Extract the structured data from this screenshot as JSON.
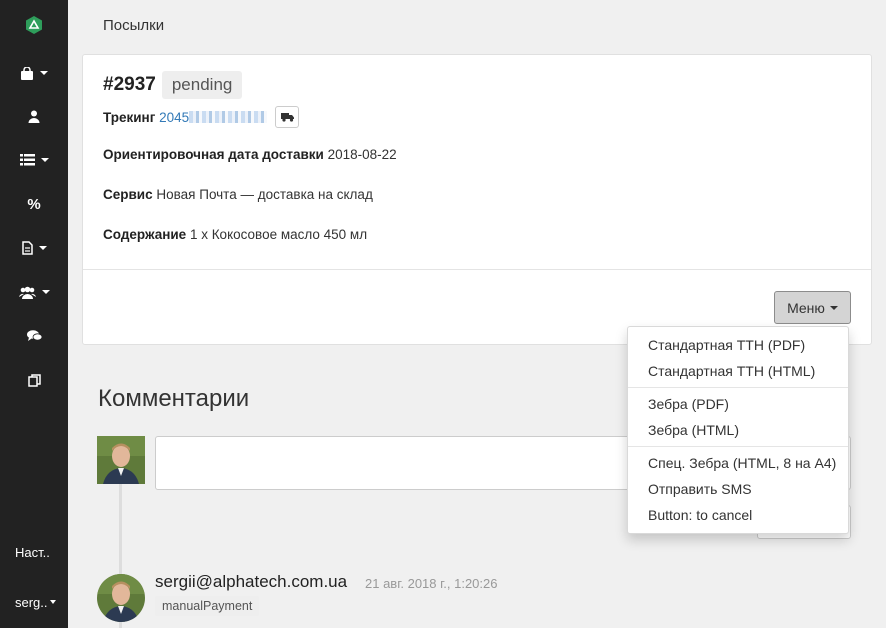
{
  "sidebar": {
    "items": [
      {
        "icon": "shopping-bag-icon",
        "has_caret": true
      },
      {
        "icon": "user-icon",
        "has_caret": false
      },
      {
        "icon": "list-icon",
        "has_caret": true
      },
      {
        "icon": "percent-icon",
        "has_caret": false
      },
      {
        "icon": "document-icon",
        "has_caret": true
      },
      {
        "icon": "users-icon",
        "has_caret": true
      },
      {
        "icon": "comments-icon",
        "has_caret": false
      },
      {
        "icon": "copy-icon",
        "has_caret": false
      }
    ],
    "settings_label": "Наст..",
    "user_label": "serg.."
  },
  "page_title": "Посылки",
  "shipment": {
    "id": "#2937",
    "status": "pending",
    "tracking_label": "Трекинг",
    "tracking_number": "2045",
    "delivery_label": "Ориентировочная дата доставки",
    "delivery_date": "2018-08-22",
    "service_label": "Сервис",
    "service_value": "Новая Почта — доставка на склад",
    "content_label": "Содержание",
    "content_value": "1 x Кокосовое масло 450 мл",
    "menu_button": "Меню"
  },
  "dropdown": {
    "items": [
      "Стандартная ТТН (PDF)",
      "Стандартная ТТН (HTML)",
      "Зебра (PDF)",
      "Зебра (HTML)",
      "Спец. Зебра (HTML, 8 на А4)",
      "Отправить SMS",
      "Button: to cancel"
    ]
  },
  "comments": {
    "title": "Комментарии",
    "entries": [
      {
        "author": "sergii@alphatech.com.ua",
        "time": "21 авг. 2018 г., 1:20:26",
        "tag": "manualPayment"
      }
    ]
  },
  "colors": {
    "sidebar_bg": "#222222",
    "logo_green": "#2e9e5b",
    "link_blue": "#337ab7"
  }
}
